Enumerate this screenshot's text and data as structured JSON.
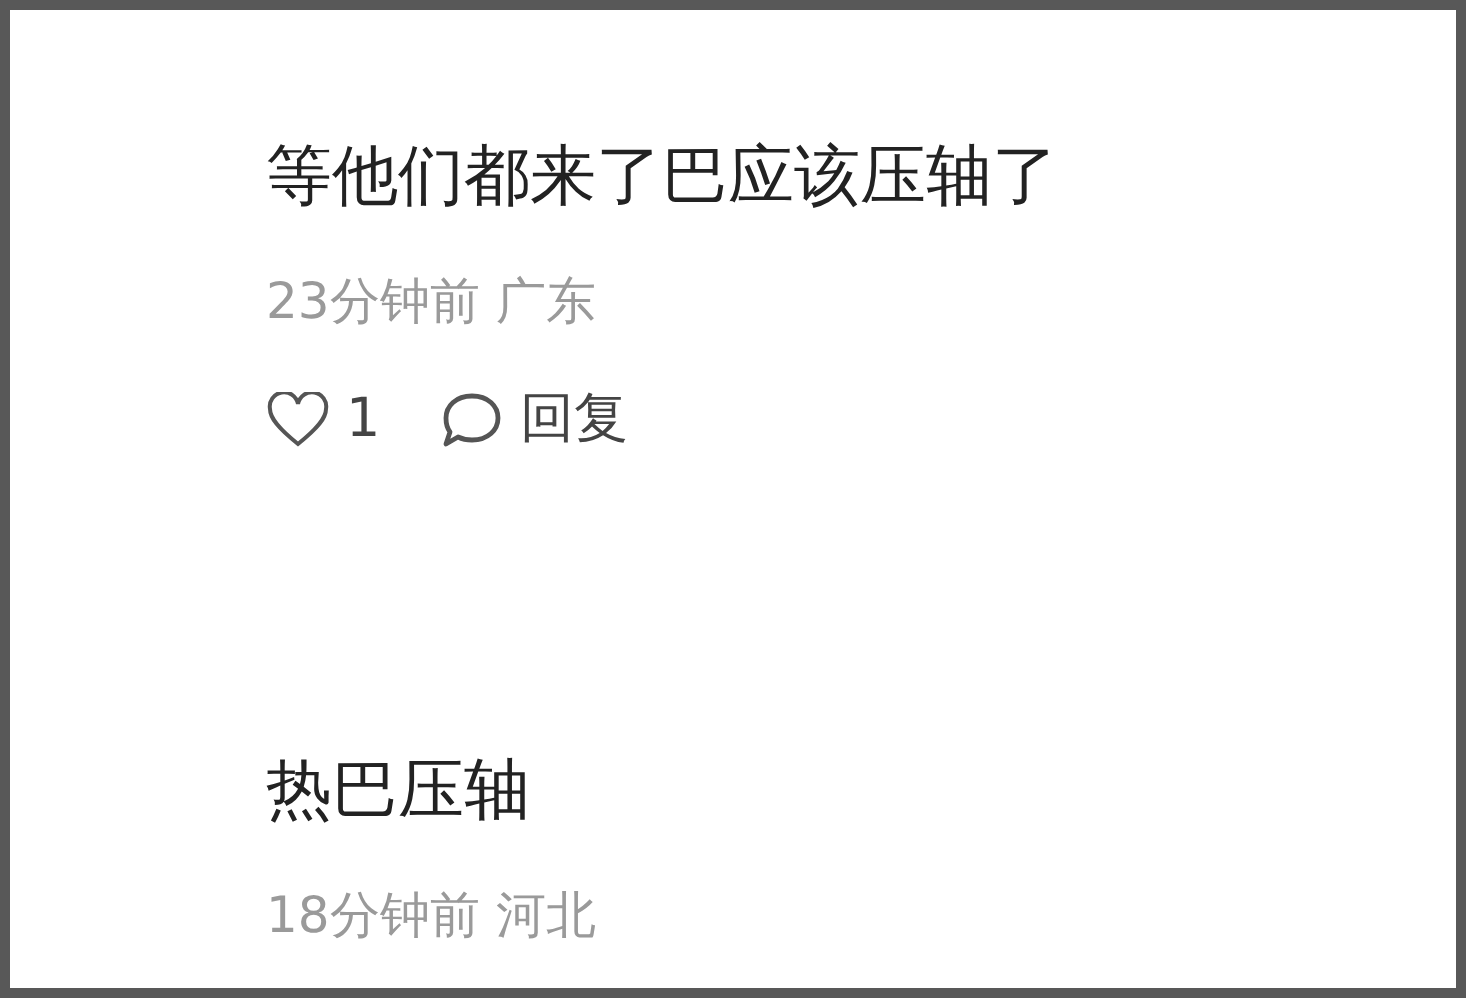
{
  "comments": [
    {
      "text": "等他们都来了巴应该压轴了",
      "time": "23分钟前",
      "location": "广东",
      "liked": false,
      "likes": "1",
      "reply_label": "回复"
    },
    {
      "text": "热巴压轴",
      "time": "18分钟前",
      "location": "河北"
    }
  ]
}
